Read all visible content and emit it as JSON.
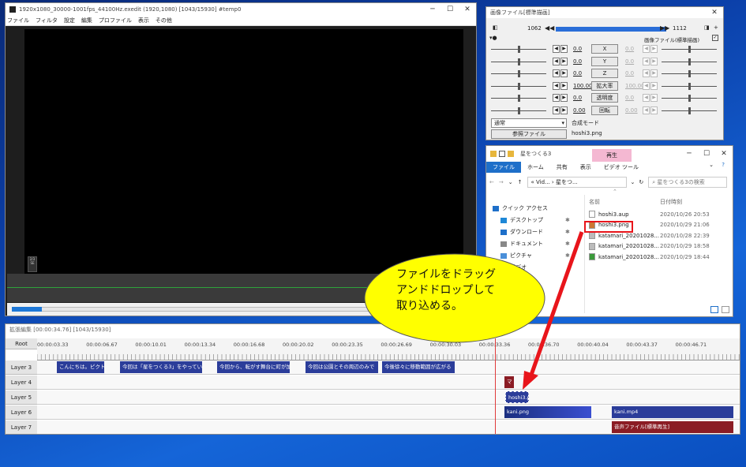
{
  "main_window": {
    "title": "1920x1080_30000-1001fps_44100Hz.exedit (1920,1080)  [1043/15930]  #temp0",
    "menu": [
      "ファイル",
      "フィルタ",
      "設定",
      "編集",
      "プロファイル",
      "表示",
      "その他"
    ],
    "badge": "2/3 SE"
  },
  "settings_window": {
    "title": "画像ファイル[標準描画]",
    "frame_start": "1062",
    "frame_end": "1112",
    "type_label": "画像ファイル(標準描画)",
    "params": [
      {
        "label": "X",
        "left": "0.0",
        "right": "0.0"
      },
      {
        "label": "Y",
        "left": "0.0",
        "right": "0.0"
      },
      {
        "label": "Z",
        "left": "0.0",
        "right": "0.0"
      },
      {
        "label": "拡大率",
        "left": "100.00",
        "right": "100.00"
      },
      {
        "label": "透明度",
        "left": "0.0",
        "right": "0.0"
      },
      {
        "label": "回転",
        "left": "0.00",
        "right": "0.00"
      }
    ],
    "blend_value": "通常",
    "blend_label": "合成モード",
    "ref_button": "参照ファイル",
    "ref_file": "hoshi3.png"
  },
  "explorer": {
    "title": "星をつくる3",
    "play_tab": "再生",
    "tabs": [
      "ファイル",
      "ホーム",
      "共有",
      "表示",
      "ビデオ ツール"
    ],
    "address": "« Vid... › 星をつ...",
    "search_placeholder": "星をつくる3の検索",
    "col_name": "名前",
    "col_date": "日付時刻",
    "nav": [
      "クイック アクセス",
      "デスクトップ",
      "ダウンロード",
      "ドキュメント",
      "ピクチャ",
      "ビデオ"
    ],
    "files": [
      {
        "name": "hoshi3.aup",
        "date": "2020/10/26 20:53"
      },
      {
        "name": "hoshi3.png",
        "date": "2020/10/29 21:06"
      },
      {
        "name": "katamari_20201028...",
        "date": "2020/10/28 22:39"
      },
      {
        "name": "katamari_20201028...",
        "date": "2020/10/29 18:58"
      },
      {
        "name": "katamari_20201028...",
        "date": "2020/10/29 18:44"
      }
    ]
  },
  "callout": {
    "line1": "ファイルをドラッグ",
    "line2": "アンドドロップして",
    "line3": "取り込める。"
  },
  "timeline": {
    "title": "拡張編集 [00:00:34.76] [1043/15930]",
    "root": "Root",
    "ticks": [
      "00:00:03.33",
      "00:00:06.67",
      "00:00:10.01",
      "00:00:13.34",
      "00:00:16.68",
      "00:00:20.02",
      "00:00:23.35",
      "00:00:26.69",
      "00:00:30.03",
      "00:00:33.36",
      "00:00:36.70",
      "00:00:40.04",
      "00:00:43.37",
      "00:00:46.71"
    ],
    "layers": [
      "Layer 3",
      "Layer 4",
      "Layer 5",
      "Layer 6",
      "Layer 7"
    ],
    "layer3_clips": [
      "こんにちは。ピクトで",
      "今回は「星をつくる3」をやっていきま",
      "今回から、転がす舞台に町が加",
      "今回は公園とその周辺のみで",
      "今後徐々に移動範囲が広がる"
    ],
    "layer4_clip": "マ",
    "layer5_clip": "hoshi3.png",
    "layer6_clips": [
      "kani.png",
      "kani.mp4"
    ],
    "layer7_clip": "音声ファイル[標準再生]"
  },
  "colors": {
    "accent_red": "#e8151b",
    "callout_fill": "#ffff00",
    "clip_blue": "#2b3d9a",
    "clip_red": "#8b1c24"
  }
}
